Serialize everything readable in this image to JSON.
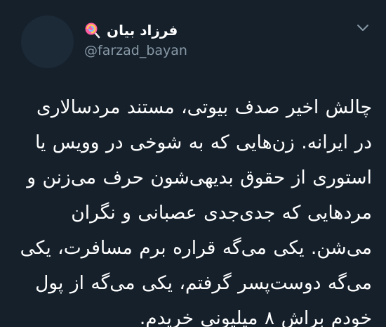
{
  "tweet": {
    "display_name": "فرزاد بیان",
    "name_emoji": "lollipop-icon",
    "handle": "@farzad_bayan",
    "body_lines": [
      "چالش اخیر صدف بیوتی، مستند مردسالاری",
      "در ایرانه. زن‌هایی که به شوخی در وویس یا",
      "استوری از حقوق بدیهی‌شون حرف می‌زنن و",
      "مردهایی که جدی‌جدی عصبانی و نگران",
      "می‌شن. یکی می‌گه قراره برم مسافرت، یکی",
      "می‌گه دوست‌پسر گرفتم، یکی می‌گه از پول",
      "خودم براش ۸ میلیونی خریدم."
    ]
  },
  "colors": {
    "background": "#15202b",
    "text_primary": "#ffffff",
    "text_secondary": "#8899a6",
    "avatar_placeholder": "#1c2a38"
  }
}
